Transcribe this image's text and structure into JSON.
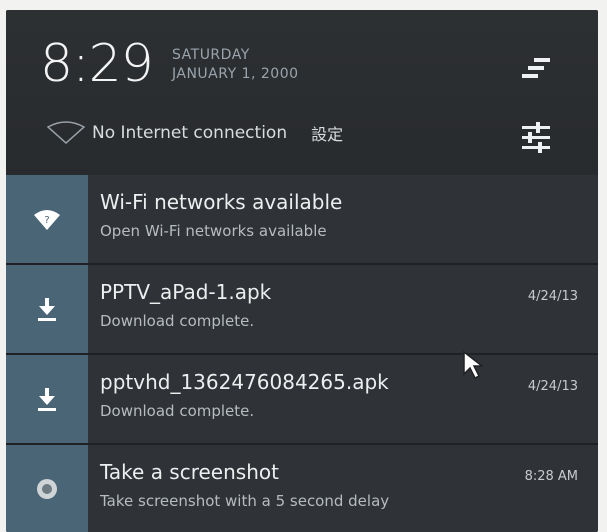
{
  "header": {
    "time": "8:29",
    "day": "SATURDAY",
    "date": "JANUARY 1, 2000",
    "connection": "No Internet connection",
    "settings_label": "設定"
  },
  "notifications": [
    {
      "title": "Wi-Fi networks available",
      "subtitle": "Open Wi-Fi networks available",
      "time": "",
      "icon": "wifi-icon"
    },
    {
      "title": "PPTV_aPad-1.apk",
      "subtitle": "Download complete.",
      "time": "4/24/13",
      "icon": "download-icon"
    },
    {
      "title": "pptvhd_1362476084265.apk",
      "subtitle": "Download complete.",
      "time": "4/24/13",
      "icon": "download-icon"
    },
    {
      "title": "Take a screenshot",
      "subtitle": "Take screenshot with a 5 second delay",
      "time": "8:28 AM",
      "icon": "screenshot-icon"
    }
  ],
  "colors": {
    "shade_background": "#2b2e31",
    "icon_tile": "#4a6576",
    "notification_background": "#2f3236"
  }
}
